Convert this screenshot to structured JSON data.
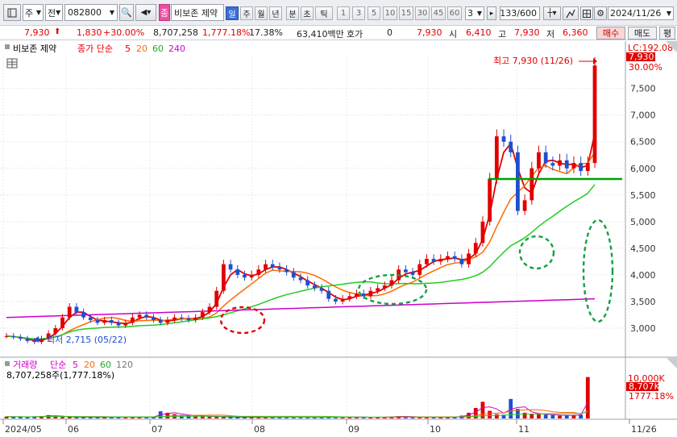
{
  "toolbar": {
    "menu_icon": "menu-icon",
    "market": "주",
    "type": "전",
    "code": "082800",
    "tag": "종",
    "name": "비보존 제약",
    "periods": [
      "일",
      "주",
      "월",
      "년",
      "분",
      "초",
      "틱"
    ],
    "active_period": "일",
    "minutes": [
      "1",
      "3",
      "5",
      "10",
      "15",
      "30",
      "45",
      "60"
    ],
    "custom_value": "3",
    "count": "133/600",
    "date": "2024/11/26"
  },
  "quote": {
    "price": "7,930",
    "change": "1,830",
    "pct": "+30.00%",
    "volume": "8,707,258",
    "vol_pct": "1,777.18%",
    "turnover": "17.38%",
    "amount": "63,410백만",
    "hoga_label": "호가",
    "hoga_val": "0",
    "hoga_price": "7,930",
    "open_label": "시",
    "open": "6,410",
    "high_label": "고",
    "high": "7,930",
    "low_label": "저",
    "low": "6,360",
    "buy": "매수",
    "sell": "매도",
    "flat": "평"
  },
  "price_panel": {
    "name": "비보존 제약",
    "ma_label": "종가 단순",
    "ma": [
      "5",
      "20",
      "60",
      "240"
    ],
    "high_note": "최고 7,930 (11/26)",
    "low_note": "최저 2,715 (05/22)",
    "lc": "LC:192.08",
    "cur_price": "7,930",
    "cur_pct": "30.00%",
    "y_labels": [
      "7,500",
      "7,000",
      "6,500",
      "6,000",
      "5,500",
      "5,000",
      "4,500",
      "4,000",
      "3,500",
      "3,000"
    ]
  },
  "volume_panel": {
    "name": "거래량",
    "ma_label": "단순",
    "ma": [
      "5",
      "20",
      "60",
      "120"
    ],
    "info": "8,707,258주(1,777.18%)",
    "y_label": "10,000K",
    "cur": "8,707K",
    "cur_pct": "1777.18%"
  },
  "x_labels": [
    "2024/05",
    "06",
    "07",
    "08",
    "09",
    "10",
    "11",
    "11/26"
  ],
  "colors": {
    "up": "#e00000",
    "down": "#1f4fd0",
    "ma5": "#e00000",
    "ma20": "#ff6a00",
    "ma60": "#22cc22",
    "ma240": "#cc00cc",
    "support": "#00a000"
  },
  "chart_data": {
    "type": "candlestick",
    "x_axis": [
      "2024/05",
      "06",
      "07",
      "08",
      "09",
      "10",
      "11",
      "11/26"
    ],
    "y_range": [
      2500,
      8100
    ],
    "support_line": 5800,
    "high": {
      "value": 7930,
      "date": "11/26"
    },
    "low": {
      "value": 2715,
      "date": "05/22"
    },
    "close_series": [
      2850,
      2830,
      2800,
      2760,
      2740,
      2800,
      2900,
      3000,
      3200,
      3400,
      3300,
      3200,
      3150,
      3100,
      3150,
      3100,
      3050,
      3100,
      3200,
      3250,
      3200,
      3150,
      3100,
      3150,
      3200,
      3180,
      3150,
      3200,
      3300,
      3400,
      3700,
      4200,
      4100,
      4000,
      3950,
      4000,
      4100,
      4200,
      4150,
      4100,
      4050,
      3950,
      3900,
      3800,
      3750,
      3700,
      3550,
      3500,
      3550,
      3600,
      3650,
      3600,
      3700,
      3750,
      3800,
      3900,
      4100,
      4050,
      4000,
      4200,
      4300,
      4250,
      4300,
      4350,
      4300,
      4200,
      4400,
      4600,
      5000,
      5800,
      6600,
      6500,
      6300,
      5200,
      5400,
      6000,
      6300,
      6100,
      6050,
      6150,
      6000,
      6100,
      5950,
      6100,
      7930
    ],
    "volume_series_k": [
      400,
      300,
      350,
      320,
      380,
      500,
      700,
      450,
      300,
      250,
      300,
      280,
      250,
      260,
      240,
      250,
      300,
      280,
      260,
      250,
      300,
      400,
      1500,
      1200,
      900,
      700,
      600,
      500,
      450,
      400,
      350,
      300,
      280,
      270,
      260,
      250,
      240,
      230,
      250,
      300,
      280,
      260,
      250,
      240,
      230,
      220,
      240,
      280,
      300,
      320,
      280,
      260,
      250,
      270,
      300,
      400,
      500,
      350,
      300,
      280,
      300,
      260,
      250,
      280,
      350,
      600,
      1200,
      2200,
      3500,
      1600,
      900,
      800,
      4100,
      2000,
      1200,
      1000,
      900,
      800,
      700,
      600,
      700,
      650,
      800,
      8707
    ]
  }
}
